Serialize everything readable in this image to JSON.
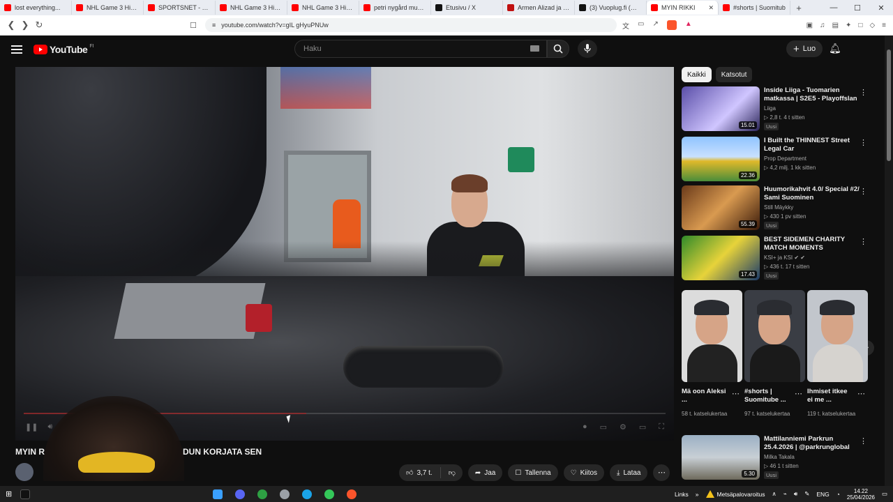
{
  "browser": {
    "tabs": [
      {
        "label": "lost everything...",
        "color": "#ff0000"
      },
      {
        "label": "NHL Game 3 Highli",
        "color": "#ff0000"
      },
      {
        "label": "SPORTSNET - YouTu",
        "color": "#ff0000"
      },
      {
        "label": "NHL Game 3 Highli",
        "color": "#ff0000"
      },
      {
        "label": "NHL Game 3 Highli",
        "color": "#ff0000"
      },
      {
        "label": "petri nygård mun h",
        "color": "#ff0000"
      },
      {
        "label": "Etusivu / X",
        "color": "#111111"
      },
      {
        "label": "Armen Alizad ja Sen",
        "color": "#c01010"
      },
      {
        "label": "(3) Vuoplug.fi (@vu",
        "color": "#111111"
      },
      {
        "label": "MYIN RIKKI",
        "color": "#ff0000",
        "active": true
      },
      {
        "label": "#shorts | Suomitub",
        "color": "#ff0000"
      }
    ],
    "new_tab": "+",
    "window_controls": [
      "—",
      "☐",
      "✕"
    ],
    "url": "youtube.com/watch?v=gIL gHyuPNUw"
  },
  "header": {
    "logo_text": "YouTube",
    "country": "FI",
    "search_placeholder": "Haku",
    "create_label": "Luo"
  },
  "video": {
    "title_left": "MYIN R",
    "title_right": "DUN KORJATA SEN",
    "progress_fraction": 0.44,
    "actions": {
      "likes": "3,7 t.",
      "share": "Jaa",
      "save": "Tallenna",
      "thanks": "Kiitos",
      "download": "Lataa"
    }
  },
  "sidebar": {
    "chips": [
      "Kaikki",
      "Katsotut"
    ],
    "recommendations": [
      {
        "title": "Inside Liiga - Tuomarien matkassa | S2E5 - Playoffslan ...",
        "channel": "Liiga",
        "meta": "▷ 2,8 t.   4 t sitten",
        "badge": "Uusi",
        "duration": "15.01",
        "bg": "linear-gradient(135deg,#5a4ea8,#d0c6ff 60%,#2a2458)"
      },
      {
        "title": "I Built the THINNEST Street Legal Car",
        "channel": "Prop Department",
        "meta": "▷ 4,2 milj.   1 kk sitten",
        "badge": "",
        "duration": "22.36",
        "bg": "linear-gradient(180deg,#8fc4ff 0%,#c8e0ff 45%,#e0b92a 55%,#4a8d3a 100%)"
      },
      {
        "title": "Huumorikahvit 4.0/ Special #2/ Sami Suominen",
        "channel": "Still Mäykky",
        "meta": "▷ 430   1 pv sitten",
        "badge": "Uusi",
        "duration": "55.39",
        "bg": "linear-gradient(135deg,#6a3a1a,#d99a50 50%,#3a1a0a)"
      },
      {
        "title": "BEST SIDEMEN CHARITY MATCH MOMENTS",
        "channel": "KSI+ ja KSI ✔ ✔",
        "meta": "▷ 436 t.   17 t sitten",
        "badge": "Uusi",
        "duration": "17.43",
        "bg": "linear-gradient(135deg,#2f8a2a,#e7d33a 50%,#1a3a6a)"
      },
      {
        "title": "Mattilanniemi Parkrun 25.4.2026 | @parkrunglobal",
        "channel": "Milka Takala",
        "meta": "▷ 46   1 t sitten",
        "badge": "Uusi",
        "duration": "5.30",
        "bg": "linear-gradient(180deg,#9bb0c4 0%,#c8cfd5 50%,#6e6a5c 100%)"
      }
    ],
    "shorts": [
      {
        "title": "Mä oon Aleksi ...",
        "views": "58 t. katselukertaa",
        "bg": "#dcdcdc",
        "body": "#222"
      },
      {
        "title": "#shorts | Suomitube ...",
        "views": "97 t. katselukertaa",
        "bg": "#3a3d44",
        "body": "#1a1a1a"
      },
      {
        "title": "Ihmiset itkee ei me ...",
        "views": "119 t. katselukertaa",
        "bg": "#c2c6cc",
        "body": "#d6d3cf"
      }
    ]
  },
  "taskbar": {
    "links": "Links",
    "weather": "Metsäpalovaroitus",
    "lang": "ENG",
    "time": "14.22",
    "date": "25/04/2026",
    "apps": [
      "#3aa0ff",
      "#5865f2",
      "#2ea043",
      "#9aa0a6",
      "#1aa3e8",
      "#34c759",
      "#fb542b"
    ]
  }
}
